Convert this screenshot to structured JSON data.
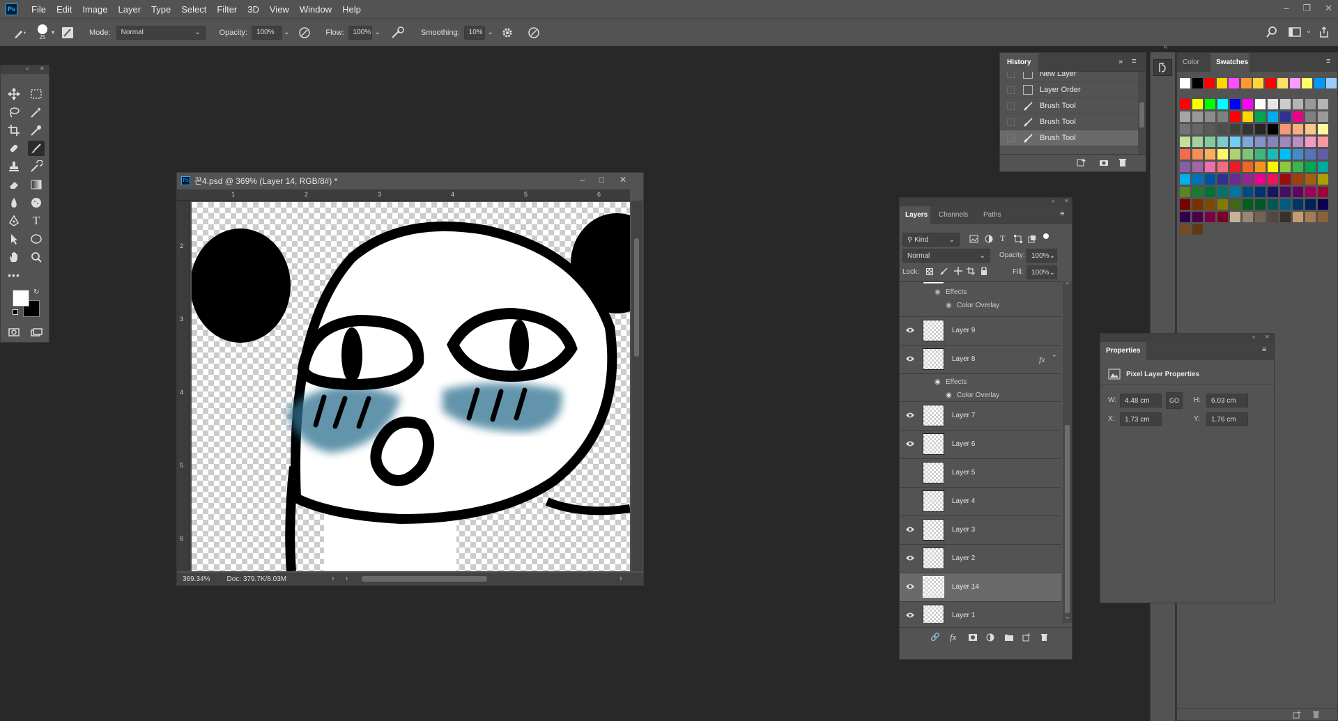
{
  "app": {
    "logo": "Ps"
  },
  "menu": [
    "File",
    "Edit",
    "Image",
    "Layer",
    "Type",
    "Select",
    "Filter",
    "3D",
    "View",
    "Window",
    "Help"
  ],
  "options": {
    "brush_size": "25",
    "mode_label": "Mode:",
    "mode_value": "Normal",
    "opacity_label": "Opacity:",
    "opacity_value": "100%",
    "flow_label": "Flow:",
    "flow_value": "100%",
    "smoothing_label": "Smoothing:",
    "smoothing_value": "10%"
  },
  "document": {
    "title": "꼰4.psd @ 369% (Layer 14, RGB/8#) *",
    "zoom": "369.34%",
    "doc_info": "Doc: 379.7K/8.03M",
    "ruler_h": [
      "1",
      "2",
      "3",
      "4",
      "5",
      "6"
    ],
    "ruler_v": [
      "2",
      "3",
      "4",
      "5",
      "6"
    ]
  },
  "history": {
    "tab": "History",
    "items": [
      {
        "label": "New Layer",
        "icon": "layer-icon"
      },
      {
        "label": "Layer Order",
        "icon": "layer-icon"
      },
      {
        "label": "Brush Tool",
        "icon": "brush-icon"
      },
      {
        "label": "Brush Tool",
        "icon": "brush-icon"
      },
      {
        "label": "Brush Tool",
        "icon": "brush-icon"
      }
    ]
  },
  "color_panel": {
    "tabs": [
      "Color",
      "Swatches"
    ],
    "active": "Swatches",
    "recent": [
      "#ffffff",
      "#000000",
      "#ff0000",
      "#ffd700",
      "#ff4dff",
      "#ff9933",
      "#ffd633",
      "#ff0000",
      "#ffe066",
      "#ff99ff",
      "#ffff66",
      "#0099ff",
      "#99ccff"
    ],
    "grid": [
      [
        "#ff0000",
        "#ffff00",
        "#00ff00",
        "#00ffff",
        "#0000ff",
        "#ff00ff",
        "#ffffff",
        "#e6e6e6",
        "#cccccc",
        "#b3b3b3",
        "#999999",
        "#b3b3b3"
      ],
      [
        "#a6a6a6",
        "#999999",
        "#8c8c8c",
        "#808080",
        "#ff0000",
        "#ffd700",
        "#00a651",
        "#00aeef",
        "#2e3192",
        "#ec008c",
        "#808080",
        "#999999"
      ],
      [
        "#737373",
        "#666666",
        "#595959",
        "#4d4d4d",
        "#404040",
        "#333333",
        "#262626",
        "#000000",
        "#f7977a",
        "#f9ad81",
        "#fdc68a",
        "#fff79a"
      ],
      [
        "#c4df9b",
        "#a3d39c",
        "#82ca9d",
        "#7bcdc8",
        "#6ecff6",
        "#7ea7d8",
        "#8493ca",
        "#8882be",
        "#a187be",
        "#bc8dbf",
        "#f49ac2",
        "#f6989d"
      ],
      [
        "#f26c4f",
        "#f68e56",
        "#fbaf5d",
        "#fff568",
        "#acd372",
        "#7cc576",
        "#3bb878",
        "#1abbb4",
        "#00bff3",
        "#438cca",
        "#5574b9",
        "#605ca8"
      ],
      [
        "#855fa8",
        "#a763a8",
        "#f06ea9",
        "#f26d7d",
        "#ed1c24",
        "#f26522",
        "#f7941d",
        "#fff200",
        "#8dc73f",
        "#39b54a",
        "#00a651",
        "#00a99d"
      ],
      [
        "#00aeef",
        "#0072bc",
        "#0054a6",
        "#2e3192",
        "#662d91",
        "#92278f",
        "#ec008c",
        "#ed145b",
        "#9e0b0f",
        "#a0410d",
        "#a36209",
        "#aba000"
      ],
      [
        "#598527",
        "#1a7b30",
        "#007236",
        "#00746b",
        "#0076a3",
        "#004b80",
        "#003471",
        "#1b1464",
        "#440e62",
        "#630460",
        "#9e005d",
        "#9e0039"
      ],
      [
        "#790000",
        "#7b2e00",
        "#7d4900",
        "#827b00",
        "#406618",
        "#005e20",
        "#005826",
        "#005952",
        "#005b7f",
        "#003663",
        "#002157",
        "#0d004c"
      ],
      [
        "#32004b",
        "#4b0049",
        "#7b0046",
        "#7a0026",
        "#c7b299",
        "#998675",
        "#736357",
        "#534741",
        "#37302d",
        "#c69c6d",
        "#a67c52",
        "#8c6239"
      ],
      [
        "#754c24",
        "#603913"
      ]
    ]
  },
  "layers_panel": {
    "tabs": [
      "Layers",
      "Channels",
      "Paths"
    ],
    "active": "Layers",
    "filter_kind": "Kind",
    "blend_mode": "Normal",
    "opacity_label": "Opacity:",
    "opacity_value": "100%",
    "lock_label": "Lock:",
    "fill_label": "Fill:",
    "fill_value": "100%",
    "effects_label": "Effects",
    "color_overlay_label": "Color Overlay",
    "fx_label": "fx",
    "layers": [
      {
        "name": "Layer 9",
        "visible": true
      },
      {
        "name": "Layer 8",
        "visible": true,
        "has_fx": true
      },
      {
        "name": "Layer 7",
        "visible": true
      },
      {
        "name": "Layer 6",
        "visible": true
      },
      {
        "name": "Layer 5",
        "visible": false
      },
      {
        "name": "Layer 4",
        "visible": false
      },
      {
        "name": "Layer 3",
        "visible": true
      },
      {
        "name": "Layer 2",
        "visible": true
      },
      {
        "name": "Layer 14",
        "visible": true,
        "selected": true
      },
      {
        "name": "Layer 1",
        "visible": true
      }
    ]
  },
  "properties_panel": {
    "title": "Properties",
    "section": "Pixel Layer Properties",
    "w_label": "W:",
    "w_value": "4.48 cm",
    "h_label": "H:",
    "h_value": "6.03 cm",
    "x_label": "X:",
    "x_value": "1.73 cm",
    "y_label": "Y:",
    "y_value": "1.76 cm",
    "link_label": "GO"
  }
}
